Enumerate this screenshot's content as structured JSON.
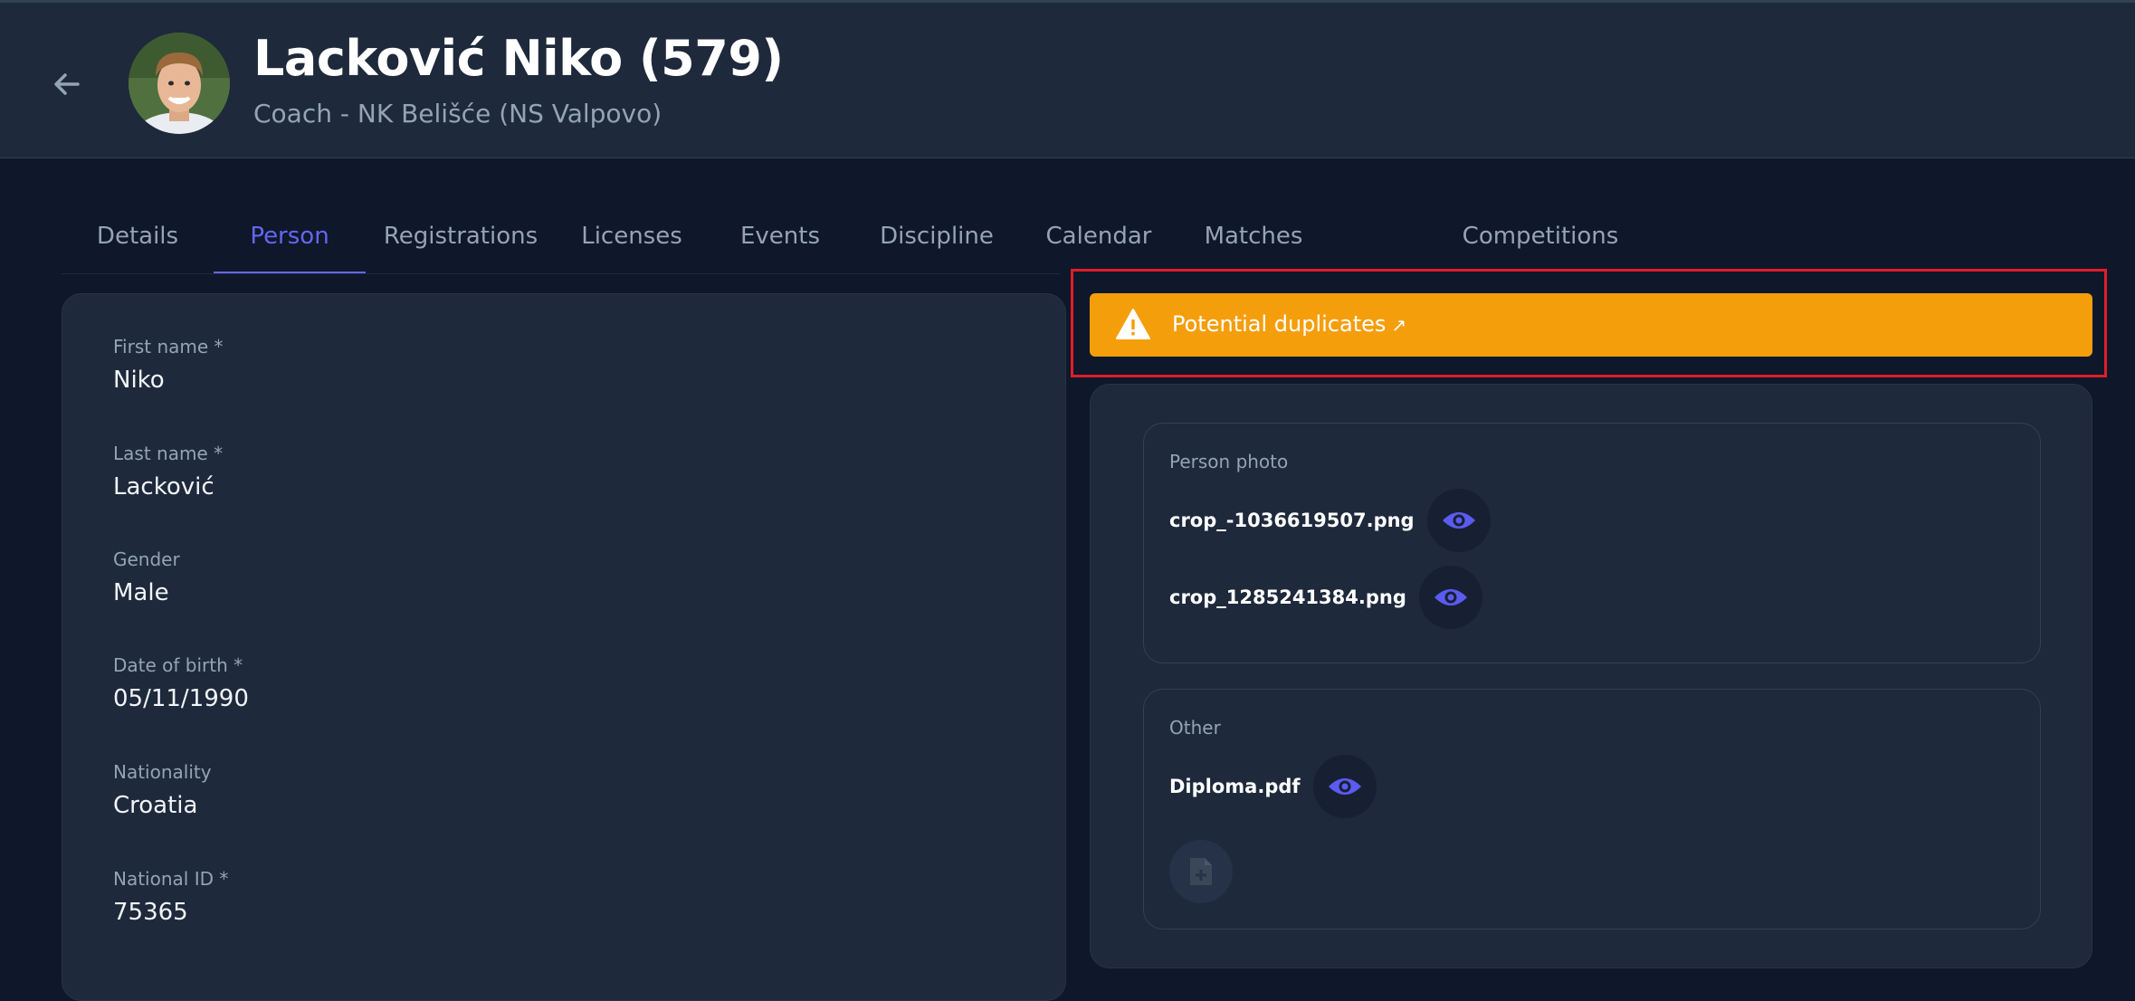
{
  "header": {
    "title": "Lacković Niko (579)",
    "subtitle": "Coach - NK Belišće (NS Valpovo)"
  },
  "tabs": [
    {
      "label": "Details"
    },
    {
      "label": "Person"
    },
    {
      "label": "Registrations"
    },
    {
      "label": "Licenses"
    },
    {
      "label": "Events"
    },
    {
      "label": "Discipline"
    },
    {
      "label": "Calendar"
    },
    {
      "label": "Matches"
    },
    {
      "label": "Competitions"
    }
  ],
  "active_tab": "Person",
  "person": {
    "fields": [
      {
        "label": "First name *",
        "value": "Niko"
      },
      {
        "label": "Last name *",
        "value": "Lacković"
      },
      {
        "label": "Gender",
        "value": "Male"
      },
      {
        "label": "Date of birth *",
        "value": "05/11/1990"
      },
      {
        "label": "Nationality",
        "value": "Croatia"
      },
      {
        "label": "National ID *",
        "value": "75365"
      }
    ]
  },
  "duplicates_banner": {
    "label": "Potential duplicates",
    "arrow": "↗"
  },
  "documents": {
    "person_photo": {
      "title": "Person photo",
      "files": [
        "crop_-1036619507.png",
        "crop_1285241384.png"
      ]
    },
    "other": {
      "title": "Other",
      "files": [
        "Diploma.pdf"
      ]
    }
  },
  "colors": {
    "background": "#0f172a",
    "card": "#1e293b",
    "accent": "#6366f1",
    "warning": "#f59e0b",
    "highlight": "#e11d2a"
  }
}
